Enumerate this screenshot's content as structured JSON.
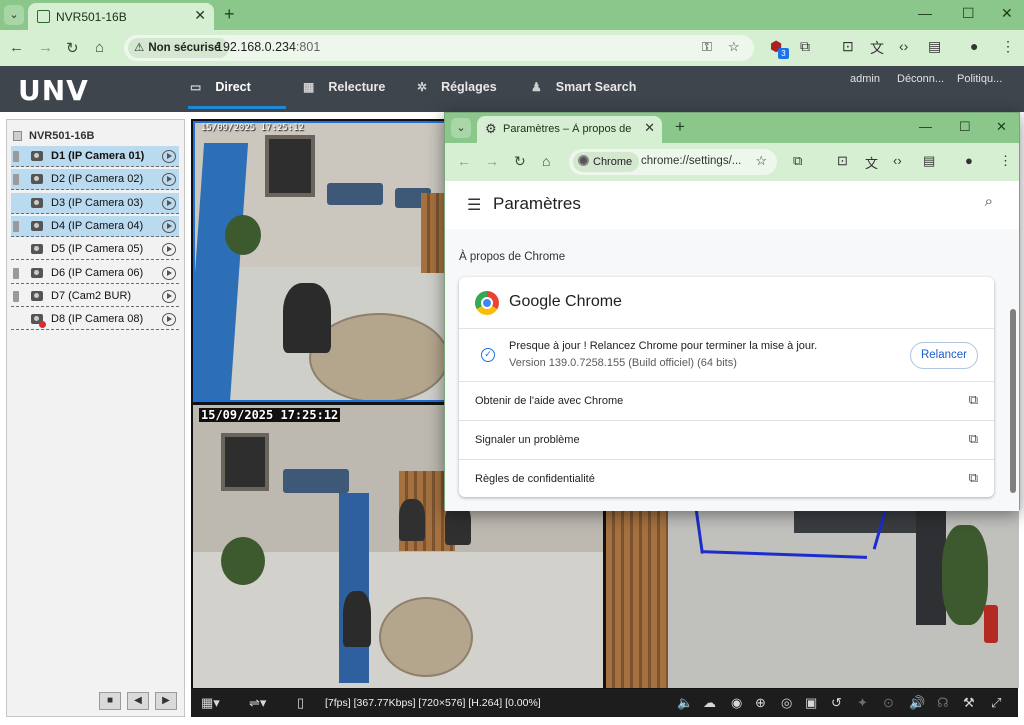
{
  "browser": {
    "tab_title": "NVR501-16B",
    "security_chip": "Non sécurisé",
    "url_host": "192.168.0.234",
    "url_port": ":801",
    "extension_badge": "3"
  },
  "app": {
    "logo": "UNV",
    "nav": [
      {
        "label": "Direct",
        "icon": "monitor-icon"
      },
      {
        "label": "Relecture",
        "icon": "film-icon"
      },
      {
        "label": "Réglages",
        "icon": "gear-icon"
      },
      {
        "label": "Smart Search",
        "icon": "person-search-icon"
      }
    ],
    "header_links": [
      "admin",
      "Déconn...",
      "Politiqu..."
    ],
    "device_tree": {
      "root": "NVR501-16B",
      "cameras": [
        {
          "label": "D1 (IP Camera 01)",
          "selected": true,
          "bold": true,
          "recording": true,
          "error": false
        },
        {
          "label": "D2 (IP Camera 02)",
          "selected": true,
          "bold": false,
          "recording": true,
          "error": false
        },
        {
          "label": "D3 (IP Camera 03)",
          "selected": true,
          "bold": false,
          "recording": false,
          "error": false
        },
        {
          "label": "D4 (IP Camera 04)",
          "selected": true,
          "bold": false,
          "recording": true,
          "error": false
        },
        {
          "label": "D5 (IP Camera 05)",
          "selected": false,
          "bold": false,
          "recording": false,
          "error": false
        },
        {
          "label": "D6 (IP Camera 06)",
          "selected": false,
          "bold": false,
          "recording": true,
          "error": false
        },
        {
          "label": "D7 (Cam2 BUR)",
          "selected": false,
          "bold": false,
          "recording": true,
          "error": false
        },
        {
          "label": "D8 (IP Camera 08)",
          "selected": false,
          "bold": false,
          "recording": false,
          "error": true
        }
      ],
      "buttons": [
        "stop",
        "previous",
        "next"
      ]
    },
    "video": {
      "osd_top_left": "15/09/2025 17:25:12",
      "osd_bottom_left": "15/09/2025 17:25:12",
      "stream_info": "[7fps] [367.77Kbps] [720×576] [H.264] [0.00%]"
    }
  },
  "settings_window": {
    "tab_title": "Paramètres – À propos de Chrome",
    "chip": "Chrome",
    "url": "chrome://settings/...",
    "page_title": "Paramètres",
    "section": "À propos de Chrome",
    "product": "Google Chrome",
    "status": "Presque à jour ! Relancez Chrome pour terminer la mise à jour.",
    "version": "Version 139.0.7258.155 (Build officiel) (64 bits)",
    "relaunch_button": "Relancer",
    "links": [
      "Obtenir de l'aide avec Chrome",
      "Signaler un problème",
      "Règles de confidentialité"
    ]
  }
}
